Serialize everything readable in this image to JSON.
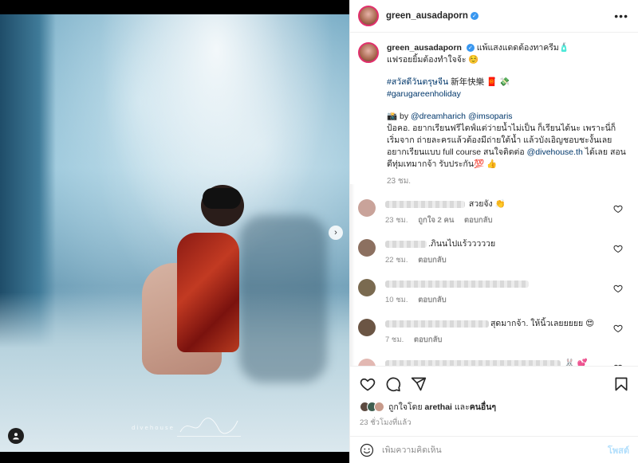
{
  "post": {
    "username": "green_ausadaporn",
    "caption_line1": "แพ้แสงแดดต้องทาครีม🧴",
    "caption_line2": "แฟรอยยิ้มต้องทำใจจ้ะ ☺️",
    "hashtag1": "#สวัสดีวันตรุษจีน",
    "hashtag1_suffix": " 新年快樂 🧧 💸",
    "hashtag2": "#garugareenholiday",
    "credit_prefix": "📸 by ",
    "credit_user1": "@dreamharich",
    "credit_user2": "@imsoparis",
    "body_text": "ป้อคอ. อยากเรียนฟรีไดฟ์แต่ว่ายน้ำไม่เป็น ก็เรียนได้นะ เพราะนี่ก็เริ่มจาก ถ่ายละครแล้วต้องมีถ่ายใต้น้ำ แล้วบังเอิญชอบชะงั้นเลยอยากเรียนแบบ full course สนใจติดต่อ ",
    "contact_user": "@divehouse.th",
    "body_tail": " ได้เลย สอนดีทุ่มเทมากจ้า รับประกัน💯 👍",
    "caption_time": "23 ชม.",
    "watermark": "divehouse"
  },
  "comments": [
    {
      "text": "สวยจัง 👏",
      "time": "23 ชม.",
      "likes": "ถูกใจ 2 คน",
      "reply": "ตอบกลับ",
      "avatar_color": "#c9a39a"
    },
    {
      "text": ".ภินนไปแร้วววววย",
      "time": "22 ชม.",
      "likes": "",
      "reply": "ตอบกลับ",
      "avatar_color": "#8c7060"
    },
    {
      "text": "",
      "time": "10 ชม.",
      "likes": "",
      "reply": "ตอบกลับ",
      "avatar_color": "#7a6a50"
    },
    {
      "text": "สุดมากจ้า. ให้นิ้วเลยยยยย 😍",
      "time": "7 ชม.",
      "likes": "",
      "reply": "ตอบกลับ",
      "avatar_color": "#6b5544"
    },
    {
      "text": "🐰 💕",
      "time": "",
      "likes": "",
      "reply": "",
      "avatar_color": "#e2b8b2"
    }
  ],
  "liked_by": {
    "prefix": "ถูกใจโดย ",
    "user": "arethai",
    "middle": " และ",
    "others": "คนอื่นๆ"
  },
  "post_time": "23 ชั่วโมงที่แล้ว",
  "add_comment": {
    "placeholder": "เพิ่มความคิดเห็น",
    "post_label": "โพสต์"
  },
  "icons": {
    "more": "more-icon",
    "heart": "heart-icon",
    "comment": "comment-icon",
    "share": "share-icon",
    "save": "bookmark-icon",
    "emoji": "emoji-icon",
    "next": "chevron-right-icon",
    "tag": "user-tag-icon"
  },
  "colors": {
    "link": "#00376b",
    "verified": "#3897f0",
    "muted": "#8e8e8e",
    "post_disabled": "#b2dffc"
  }
}
